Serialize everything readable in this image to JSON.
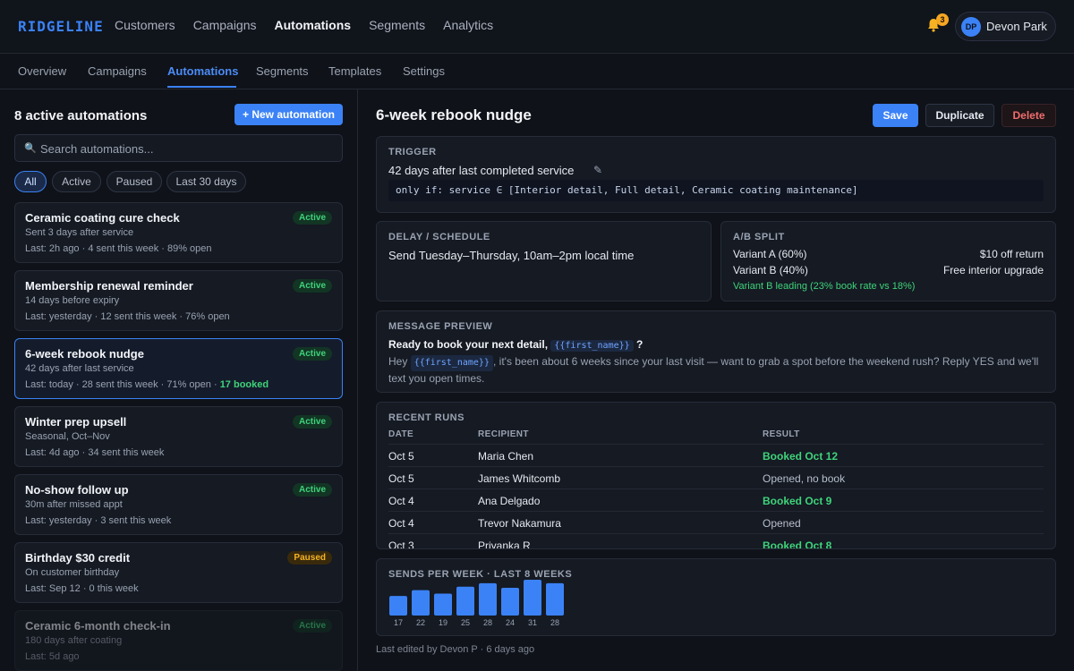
{
  "app": {
    "logo": "RIDGELINE",
    "nav": [
      "Customers",
      "Campaigns",
      "Automations",
      "Segments",
      "Analytics"
    ],
    "active_nav": "Automations",
    "notifications_count": "3",
    "user": {
      "initials": "DP",
      "name": "Devon Park"
    }
  },
  "subnav": {
    "tabs": [
      "Overview",
      "Campaigns",
      "Automations",
      "Segments",
      "Templates",
      "Settings"
    ],
    "active": "Automations"
  },
  "list": {
    "title": "8 active automations",
    "new_button": "+ New automation",
    "search_placeholder": "Search automations...",
    "filters": [
      "All",
      "Active",
      "Paused",
      "Last 30 days"
    ],
    "active_filter": "All",
    "items": [
      {
        "title": "Ceramic coating cure check",
        "status": "Active",
        "subtitle": "Sent 3 days after service",
        "meta": "Last: 2h ago  ·  4 sent this week  ·  89% open",
        "booked": ""
      },
      {
        "title": "Membership renewal reminder",
        "status": "Active",
        "subtitle": "14 days before expiry",
        "meta": "Last: yesterday  ·  12 sent this week  ·  76% open",
        "booked": ""
      },
      {
        "title": "6-week rebook nudge",
        "status": "Active",
        "subtitle": "42 days after last service",
        "meta": "Last: today  ·  28 sent this week  ·  71% open  ·  ",
        "booked": "17 booked"
      },
      {
        "title": "Winter prep upsell",
        "status": "Active",
        "subtitle": "Seasonal, Oct–Nov",
        "meta": "Last: 4d ago  ·  34 sent this week",
        "booked": ""
      },
      {
        "title": "No-show follow up",
        "status": "Active",
        "subtitle": "30m after missed appt",
        "meta": "Last: yesterday  ·  3 sent this week",
        "booked": ""
      },
      {
        "title": "Birthday $30 credit",
        "status": "Paused",
        "subtitle": "On customer birthday",
        "meta": "Last: Sep 12  ·  0 this week",
        "booked": ""
      },
      {
        "title": "Ceramic 6-month check-in",
        "status": "Active",
        "subtitle": "180 days after coating",
        "meta": "Last: 5d ago",
        "booked": ""
      }
    ]
  },
  "detail": {
    "title": "6-week rebook nudge",
    "actions": {
      "save": "Save",
      "duplicate": "Duplicate",
      "delete": "Delete"
    },
    "trigger": {
      "label": "TRIGGER",
      "text": "42 days after last completed service",
      "edit_icon": "pencil-icon",
      "condition": "only if: service ∈ [Interior detail, Full detail, Ceramic coating maintenance]"
    },
    "delay": {
      "label": "DELAY / SCHEDULE",
      "text": "Send Tuesday–Thursday, 10am–2pm local time"
    },
    "ab_split": {
      "label": "A/B SPLIT",
      "variant_a": "Variant A (60%)",
      "variant_a_offer": "$10 off return",
      "variant_b": "Variant B (40%)",
      "variant_b_offer": "Free interior upgrade",
      "leading": "Variant B leading (23% book rate vs 18%)"
    },
    "message": {
      "label": "MESSAGE PREVIEW",
      "subject_pre": "Ready to book your next detail, ",
      "subject_token": "{{first_name}}",
      "subject_post": " ?",
      "body_pre": "Hey ",
      "body_token": "{{first_name}}",
      "body_post": ", it's been about 6 weeks since your last visit — want to grab a spot before the weekend rush? Reply YES and we'll text you open times."
    },
    "runs": {
      "label": "RECENT RUNS",
      "columns": [
        "DATE",
        "RECIPIENT",
        "RESULT"
      ],
      "rows": [
        {
          "date": "Oct 5",
          "recipient": "Maria Chen",
          "result": "Booked Oct 12",
          "booked": true
        },
        {
          "date": "Oct 5",
          "recipient": "James Whitcomb",
          "result": "Opened, no book",
          "booked": false
        },
        {
          "date": "Oct 4",
          "recipient": "Ana Delgado",
          "result": "Booked Oct 9",
          "booked": true
        },
        {
          "date": "Oct 4",
          "recipient": "Trevor Nakamura",
          "result": "Opened",
          "booked": false
        },
        {
          "date": "Oct 3",
          "recipient": "Priyanka R",
          "result": "Booked Oct 8",
          "booked": true
        }
      ]
    },
    "footer": "Last edited by Devon P · 6 days ago"
  },
  "chart_data": {
    "type": "bar",
    "title": "SENDS PER WEEK · LAST 8 WEEKS",
    "categories": [],
    "values": [
      17,
      22,
      19,
      25,
      28,
      24,
      31,
      28
    ],
    "xlabel": "",
    "ylabel": "",
    "ylim": [
      0,
      31
    ],
    "grid": false,
    "color": "#3b82f6"
  },
  "colors": {
    "accent": "#3b82f6",
    "success": "#3fd37a",
    "warning": "#f5b323",
    "danger": "#f26d6d"
  }
}
